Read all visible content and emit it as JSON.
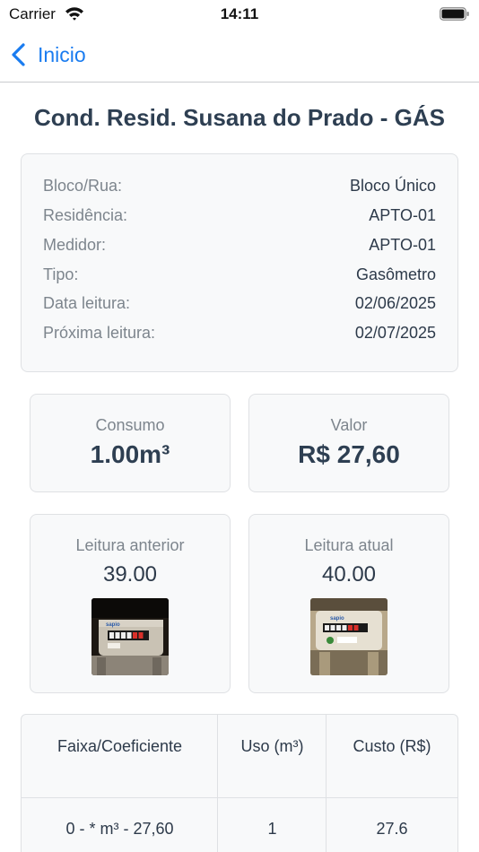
{
  "status_bar": {
    "carrier": "Carrier",
    "time": "14:11"
  },
  "nav": {
    "back_label": "Inicio"
  },
  "title": "Cond. Resid. Susana do Prado - GÁS",
  "info": [
    {
      "label": "Bloco/Rua:",
      "value": "Bloco Único"
    },
    {
      "label": "Residência:",
      "value": "APTO-01"
    },
    {
      "label": "Medidor:",
      "value": "APTO-01"
    },
    {
      "label": "Tipo:",
      "value": "Gasômetro"
    },
    {
      "label": "Data leitura:",
      "value": "02/06/2025"
    },
    {
      "label": "Próxima leitura:",
      "value": "02/07/2025"
    }
  ],
  "consumo": {
    "label": "Consumo",
    "value": "1.00m³"
  },
  "valor": {
    "label": "Valor",
    "value": "R$ 27,60"
  },
  "leitura_anterior": {
    "label": "Leitura anterior",
    "value": "39.00",
    "photo_icon": "gas-meter-photo"
  },
  "leitura_atual": {
    "label": "Leitura atual",
    "value": "40.00",
    "photo_icon": "gas-meter-photo"
  },
  "table": {
    "headers": [
      "Faixa/Coeficiente",
      "Uso (m³)",
      "Custo (R$)"
    ],
    "rows": [
      [
        "0 - * m³ - 27,60",
        "1",
        "27.6"
      ]
    ]
  },
  "colors": {
    "accent": "#1a7cf0",
    "title": "#2e3f52",
    "muted": "#7d858d",
    "card_bg": "#f8f9fa"
  }
}
